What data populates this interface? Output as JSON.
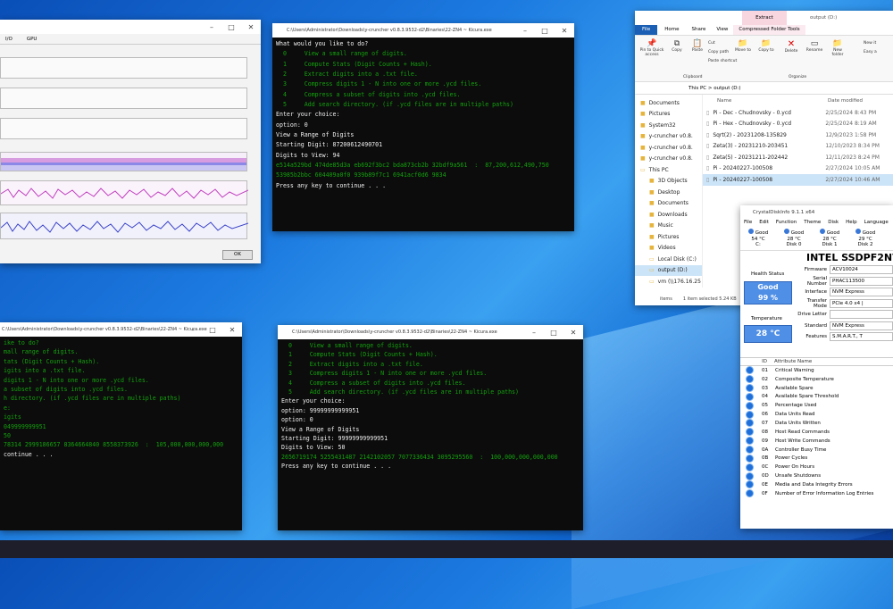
{
  "task_manager": {
    "tabs": [
      "I/O",
      "GPU"
    ],
    "ok_label": "OK"
  },
  "console_top": {
    "title": "C:\\Users\\Administrator\\Downloads\\y-cruncher v0.8.3.9532-d2\\Binaries\\22-ZN4 ~ Kicura.exe",
    "lines": [
      "What would you like to do?",
      "",
      "  0     View a small range of digits.",
      "  1     Compute Stats (Digit Counts + Hash).",
      "  2     Extract digits into a .txt file.",
      "  3     Compress digits 1 - N into one or more .ycd files.",
      "  4     Compress a subset of digits into .ycd files.",
      "",
      "  5     Add search directory. (if .ycd files are in multiple paths)",
      "",
      "Enter your choice:",
      "option: 0",
      "",
      "",
      "View a Range of Digits",
      "",
      "Starting Digit: 87200612490701",
      "",
      "Digits to View: 94",
      "",
      "e514a529bd 474de85d3a eb692f3bc2 bda873cb2b 32bdf9a561  :  87,200,612,490,750",
      "53985b2bbc 604409a0f0 939b89f7c1 6941acf0d6 9834",
      "",
      "Press any key to continue . . ."
    ]
  },
  "console_left": {
    "title": "C:\\Users\\Administrator\\Downloads\\y-cruncher v0.8.3.9532-d2\\Binaries\\22-ZN4 ~ Kicura.exe",
    "lines": [
      "ike to do?",
      "",
      "mall range of digits.",
      "tats (Digit Counts + Hash).",
      "igits into a .txt file.",
      "digits 1 - N into one or more .ycd files.",
      "a subset of digits into .ycd files.",
      "",
      "h directory. (if .ycd files are in multiple paths)",
      "",
      "e:",
      "",
      "",
      "",
      "igits",
      "",
      "049999999951",
      "",
      "50",
      "",
      "78314 2999186657 8364664840 8558373926  :  105,000,000,000,000",
      "",
      "",
      "continue . . ."
    ]
  },
  "console_mid": {
    "title": "C:\\Users\\Administrator\\Downloads\\y-cruncher v0.8.3.9532-d2\\Binaries\\22-ZN4 ~ Kicura.exe",
    "lines": [
      "  0     View a small range of digits.",
      "  1     Compute Stats (Digit Counts + Hash).",
      "  2     Extract digits into a .txt file.",
      "  3     Compress digits 1 - N into one or more .ycd files.",
      "  4     Compress a subset of digits into .ycd files.",
      "",
      "  5     Add search directory. (if .ycd files are in multiple paths)",
      "",
      "Enter your choice:",
      "option: 99999999999951",
      "option: 0",
      "",
      "",
      "View a Range of Digits",
      "",
      "Starting Digit: 99999999999951",
      "",
      "Digits to View: 50",
      "",
      "2656719174 5255431487 2142102057 7077336434 3095295560  :  100,000,000,000,000",
      "",
      "",
      "Press any key to continue . . ."
    ]
  },
  "explorer": {
    "tab_extract": "Extract",
    "tab_path": "output (D:)",
    "ribbon_tabs": [
      "File",
      "Home",
      "Share",
      "View",
      "Compressed Folder Tools"
    ],
    "ribbon_buttons": [
      "Pin to Quick access",
      "Copy",
      "Paste",
      "Move to",
      "Copy to",
      "Delete",
      "Rename",
      "New folder"
    ],
    "ribbon_small": [
      "Cut",
      "Copy path",
      "Paste shortcut"
    ],
    "ribbon_right": "New it",
    "ribbon_right2": "Easy a",
    "groups": [
      "Clipboard",
      "Organize"
    ],
    "breadcrumb": "This PC  >  output (D:)",
    "col_name": "Name",
    "col_date": "Date modified",
    "nav": [
      "Documents",
      "Pictures",
      "System32",
      "y-cruncher v0.8.",
      "y-cruncher v0.8.",
      "y-cruncher v0.8.",
      "This PC",
      "3D Objects",
      "Desktop",
      "Documents",
      "Downloads",
      "Music",
      "Pictures",
      "Videos",
      "Local Disk (C:)",
      "output (D:)",
      "vm (\\\\176.16.25"
    ],
    "files": [
      {
        "name": "Pi - Dec - Chudnovsky - 0.ycd",
        "date": "2/25/2024 8:43 PM"
      },
      {
        "name": "Pi - Hex - Chudnovsky - 0.ycd",
        "date": "2/25/2024 8:19 AM"
      },
      {
        "name": "Sqrt(2) - 20231208-135829",
        "date": "12/9/2023 1:58 PM"
      },
      {
        "name": "Zeta(3) - 20231210-203451",
        "date": "12/10/2023 8:34 PM"
      },
      {
        "name": "Zeta(5) - 20231211-202442",
        "date": "12/11/2023 8:24 PM"
      },
      {
        "name": "Pi - 20240227-100508",
        "date": "2/27/2024 10:05 AM"
      },
      {
        "name": "Pi - 20240227-100508",
        "date": "2/27/2024 10:46 AM"
      }
    ],
    "status_count": "items",
    "status_sel": "1 item selected  5.24 KB"
  },
  "cdi": {
    "title": "CrystalDiskInfo 9.1.1 x64",
    "menu": [
      "File",
      "Edit",
      "Function",
      "Theme",
      "Disk",
      "Help",
      "Language"
    ],
    "drives": [
      {
        "status": "Good",
        "temp": "54 °C",
        "label": "C:"
      },
      {
        "status": "Good",
        "temp": "28 °C",
        "label": "Disk 0"
      },
      {
        "status": "Good",
        "temp": "28 °C",
        "label": "Disk 1"
      },
      {
        "status": "Good",
        "temp": "29 °C",
        "label": "Disk 2"
      }
    ],
    "model": "INTEL SSDPF2NV3",
    "health_label": "Health Status",
    "health_status": "Good",
    "health_pct": "99 %",
    "temp_label": "Temperature",
    "temp": "28 °C",
    "fields": [
      {
        "k": "Firmware",
        "v": "ACV10024"
      },
      {
        "k": "Serial Number",
        "v": "PHAC113500"
      },
      {
        "k": "Interface",
        "v": "NVM Express"
      },
      {
        "k": "Transfer Mode",
        "v": "PCIe 4.0 x4 |"
      },
      {
        "k": "Drive Letter",
        "v": ""
      },
      {
        "k": "Standard",
        "v": "NVM Express"
      },
      {
        "k": "Features",
        "v": "S.M.A.R.T., T"
      }
    ],
    "col_id": "ID",
    "col_attr": "Attribute Name",
    "attrs": [
      {
        "id": "01",
        "name": "Critical Warning"
      },
      {
        "id": "02",
        "name": "Composite Temperature"
      },
      {
        "id": "03",
        "name": "Available Spare"
      },
      {
        "id": "04",
        "name": "Available Spare Threshold"
      },
      {
        "id": "05",
        "name": "Percentage Used"
      },
      {
        "id": "06",
        "name": "Data Units Read"
      },
      {
        "id": "07",
        "name": "Data Units Written"
      },
      {
        "id": "08",
        "name": "Host Read Commands"
      },
      {
        "id": "09",
        "name": "Host Write Commands"
      },
      {
        "id": "0A",
        "name": "Controller Busy Time"
      },
      {
        "id": "0B",
        "name": "Power Cycles"
      },
      {
        "id": "0C",
        "name": "Power On Hours"
      },
      {
        "id": "0D",
        "name": "Unsafe Shutdowns"
      },
      {
        "id": "0E",
        "name": "Media and Data Integrity Errors"
      },
      {
        "id": "0F",
        "name": "Number of Error Information Log Entries"
      }
    ]
  }
}
